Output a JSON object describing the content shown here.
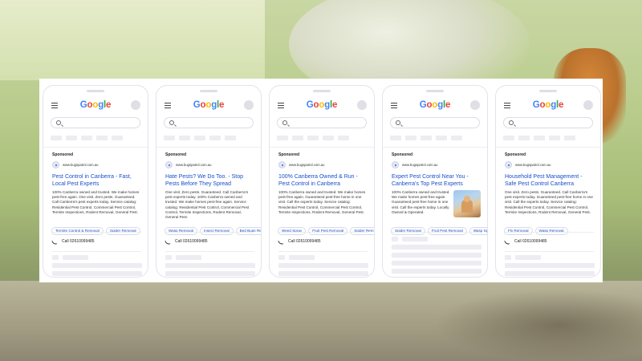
{
  "logo": [
    "G",
    "o",
    "o",
    "g",
    "l",
    "e"
  ],
  "logo_colors": [
    "#4285F4",
    "#EA4335",
    "#FBBC05",
    "#4285F4",
    "#34A853",
    "#EA4335"
  ],
  "sponsored_label": "Sponsored",
  "url": "www.bugspatrol.com.au",
  "phones": [
    {
      "title": "Pest Control in Canberra - Fast, Local Pest Experts",
      "body": "100% Canberra owned and trusted. We make homes pest-free again. One visit. Zero pests. Guaranteed. Call Canberra's pest experts today. Service catalog: Residential Pest Control, Commercial Pest Control, Termite Inspections, Rodent Removal, General Pest.",
      "chips": [
        "Termite Control & Removal",
        "Spider Removal"
      ],
      "call": "Call 02610099485"
    },
    {
      "title": "Hate Pests? We Do Too. - Stop Pests Before They Spread",
      "body": "One visit. Zero pests. Guaranteed. Call Canberra's pest experts today. 100% Canberra owned and trusted. We make homes pest-free again. Service catalog: Residential Pest Control, Commercial Pest Control, Termite Inspections, Rodent Removal, General Pest.",
      "chips": [
        "Wasp Removal",
        "Insect Removal",
        "Bed Bugs Re"
      ],
      "call": "Call 02610099485"
    },
    {
      "title": "100% Canberra Owned & Run - Pest Control in Canberra",
      "body": "100% Canberra owned and trusted. We make homes pest-free again. Guaranteed pest-free home in one visit. Call the experts today. Service catalog: Residential Pest Control, Commercial Pest Control, Termite Inspections, Rodent Removal, General Pest.",
      "chips": [
        "Weed Spray",
        "Fruit Pest Removal",
        "Spider Rem"
      ],
      "call": "Call 02610099485"
    },
    {
      "title": "Expert Pest Control Near You - Canberra's Top Pest Experts",
      "body": "100% Canberra owned and trusted. We make homes pest-free again. Guaranteed pest-free home in one visit. Call the experts today. Locally Owned & Operated.",
      "chips": [
        "Spider Removal",
        "Fruit Pest Removal",
        "Wasp Sp"
      ],
      "call": ""
    },
    {
      "title": "Household Pest Management - Safe Pest Control Canberra",
      "body": "One visit. Zero pests. Guaranteed. Call Canberra's pest experts today. Guaranteed pest-free home in one visit. Call the experts today. Service catalog: Residential Pest Control, Commercial Pest Control, Termite Inspections, Rodent Removal, General Pest.",
      "chips": [
        "Fly Removal",
        "Wasp Removal"
      ],
      "call": "Call 02610099485"
    }
  ]
}
